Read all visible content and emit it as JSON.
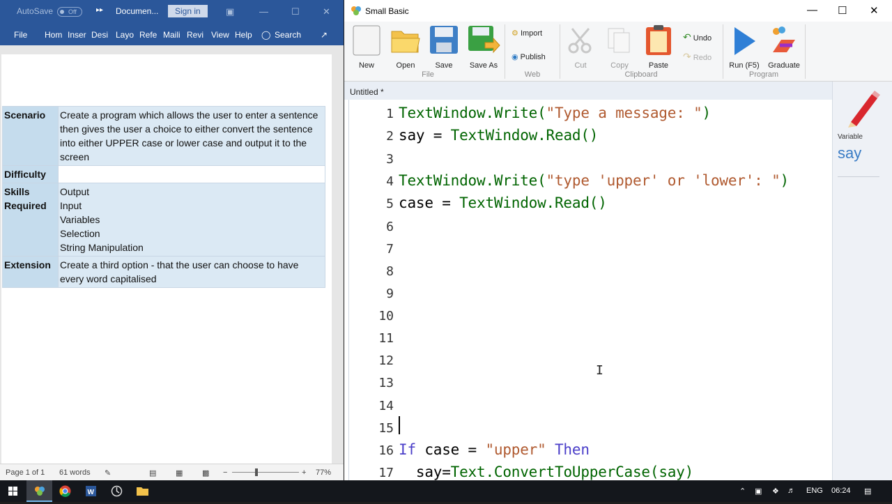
{
  "word": {
    "autosave_label": "AutoSave",
    "autosave_state": "Off",
    "doc_name": "Documen...",
    "signin": "Sign in",
    "tabs": [
      "File",
      "Hom",
      "Inser",
      "Desi",
      "Layo",
      "Refe",
      "Maili",
      "Revi",
      "View",
      "Help"
    ],
    "search": "Search",
    "table": {
      "scenario_h": "Scenario",
      "scenario": "Create a program which allows the user to enter a sentence then gives the user a choice to either convert the sentence into either UPPER case or lower case and output it to the screen",
      "difficulty_h": "Difficulty",
      "difficulty": "",
      "skills_h": "Skills Required",
      "skills": [
        "Output",
        "Input",
        "Variables",
        "Selection",
        "String Manipulation"
      ],
      "extension_h": "Extension",
      "extension": "Create a third option - that the user can choose to have every word capitalised"
    },
    "status": {
      "page": "Page 1 of 1",
      "words": "61 words",
      "zoom": "77%"
    }
  },
  "sb": {
    "title": "Small Basic",
    "ribbon": {
      "new": "New",
      "open": "Open",
      "save": "Save",
      "save_as": "Save As",
      "group_file": "File",
      "import": "Import",
      "publish": "Publish",
      "group_web": "Web",
      "cut": "Cut",
      "copy": "Copy",
      "paste": "Paste",
      "undo": "Undo",
      "redo": "Redo",
      "group_clipboard": "Clipboard",
      "run": "Run (F5)",
      "graduate": "Graduate",
      "group_program": "Program"
    },
    "doc_tab": "Untitled *",
    "line_numbers": [
      "1",
      "2",
      "3",
      "4",
      "5",
      "6",
      "7",
      "8",
      "9",
      "10",
      "11",
      "12",
      "13",
      "14",
      "15",
      "16",
      "17"
    ],
    "code": {
      "l1_obj": "TextWindow",
      "l1_mid": ".Write(",
      "l1_str": "\"Type a message: \"",
      "l1_end": ")",
      "l2_var": "say = ",
      "l2_obj": "TextWindow",
      "l2_end": ".Read()",
      "l4_obj": "TextWindow",
      "l4_mid": ".Write(",
      "l4_str": "\"type 'upper' or 'lower': \"",
      "l4_end": ")",
      "l5_var": "case = ",
      "l5_obj": "TextWindow",
      "l5_end": ".Read()",
      "l16_kw1": "If",
      "l16_mid": " case = ",
      "l16_str": "\"upper\"",
      "l16_kw2": " Then",
      "l17_var": "  say=",
      "l17_obj": "Text",
      "l17_end": ".ConvertToUpperCase(say)"
    },
    "side": {
      "label": "Variable",
      "value": "say"
    }
  },
  "taskbar": {
    "lang": "ENG",
    "time": "06:24"
  }
}
